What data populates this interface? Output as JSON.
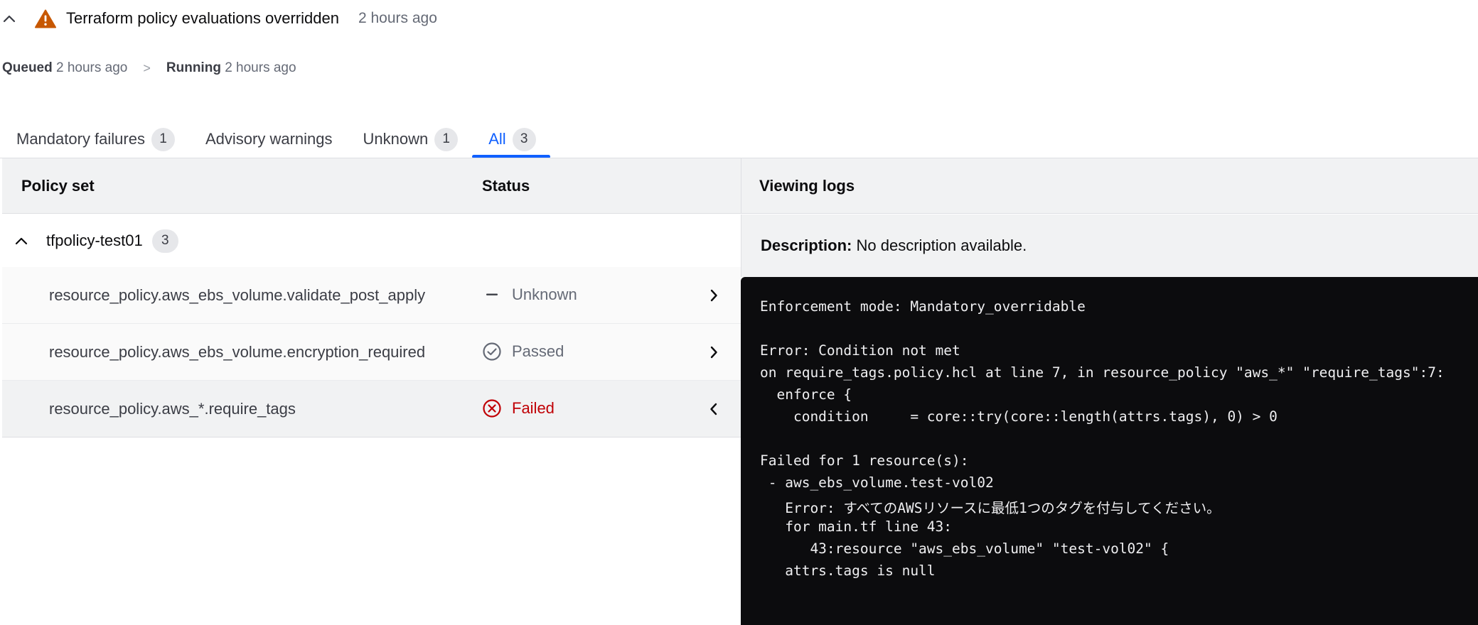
{
  "header": {
    "title": "Terraform policy evaluations overridden",
    "time": "2 hours ago"
  },
  "timeline": {
    "queued_label": "Queued",
    "queued_time": "2 hours ago",
    "separator": ">",
    "running_label": "Running",
    "running_time": "2 hours ago"
  },
  "tabs": [
    {
      "label": "Mandatory failures",
      "count": "1"
    },
    {
      "label": "Advisory warnings",
      "count": ""
    },
    {
      "label": "Unknown",
      "count": "1"
    },
    {
      "label": "All",
      "count": "3",
      "active": true
    }
  ],
  "table": {
    "col_policy_set": "Policy set",
    "col_status": "Status",
    "group": {
      "name": "tfpolicy-test01",
      "count": "3"
    },
    "rows": [
      {
        "policy": "resource_policy.aws_ebs_volume.validate_post_apply",
        "status": "Unknown",
        "status_icon": "minus-icon",
        "arrow": "chevron-right-icon"
      },
      {
        "policy": "resource_policy.aws_ebs_volume.encryption_required",
        "status": "Passed",
        "status_icon": "check-circle-icon",
        "arrow": "chevron-right-icon"
      },
      {
        "policy": "resource_policy.aws_*.require_tags",
        "status": "Failed",
        "status_icon": "x-circle-icon",
        "arrow": "chevron-left-icon",
        "selected": true
      }
    ]
  },
  "logs_panel": {
    "title": "Viewing logs",
    "description_label": "Description:",
    "description_value": "No description available.",
    "lines": [
      "Enforcement mode: Mandatory_overridable",
      "",
      "Error: Condition not met",
      "on require_tags.policy.hcl at line 7, in resource_policy \"aws_*\" \"require_tags\":7:",
      "  enforce {",
      "    condition     = core::try(core::length(attrs.tags), 0) > 0",
      "",
      "Failed for 1 resource(s):",
      " - aws_ebs_volume.test-vol02",
      "   Error: すべてのAWSリソースに最低1つのタグを付与してください。",
      "   for main.tf line 43:",
      "      43:resource \"aws_ebs_volume\" \"test-vol02\" {",
      "   attrs.tags is null"
    ]
  },
  "colors": {
    "accent": "#1060ff",
    "warning": "#c75700",
    "failed": "#c00005",
    "log_bg": "#0c0c0e"
  }
}
